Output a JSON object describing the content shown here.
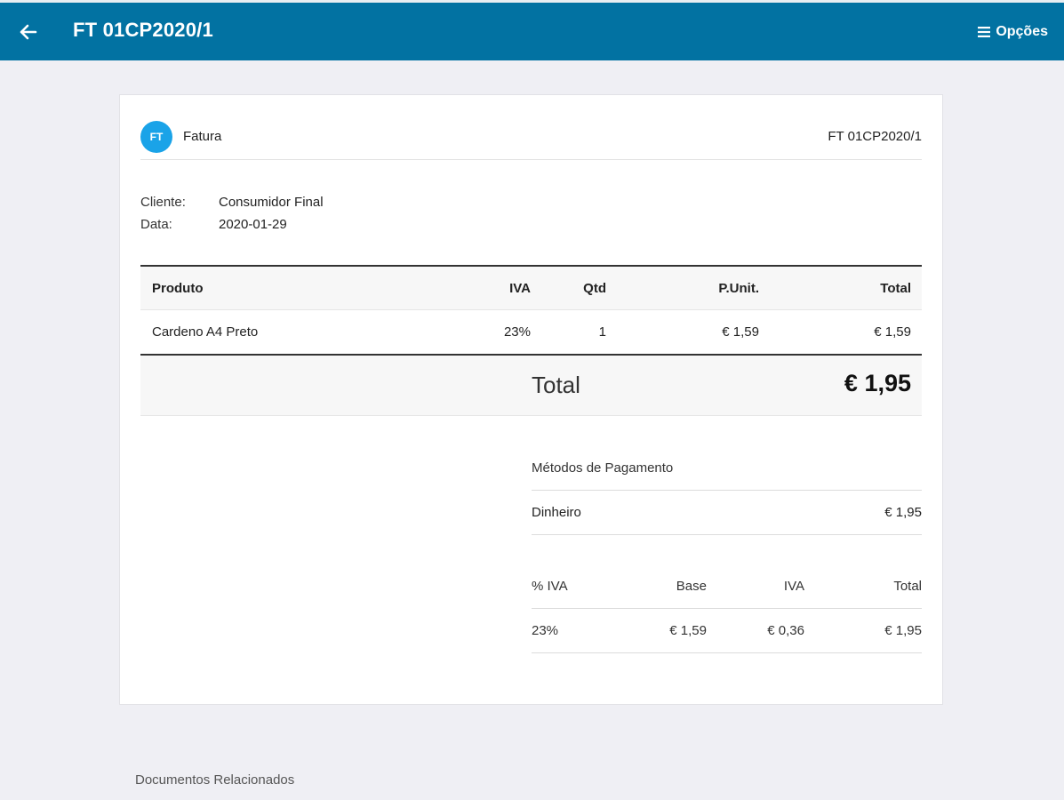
{
  "header": {
    "title": "FT 01CP2020/1",
    "options_label": "Opções",
    "accent": "#0272a2"
  },
  "document": {
    "badge": "FT",
    "type": "Fatura",
    "number": "FT 01CP2020/1",
    "client_label": "Cliente:",
    "client_value": "Consumidor Final",
    "date_label": "Data:",
    "date_value": "2020-01-29"
  },
  "items": {
    "headers": {
      "product": "Produto",
      "vat": "IVA",
      "qty": "Qtd",
      "unit_price": "P.Unit.",
      "total": "Total"
    },
    "rows": [
      {
        "product": "Cardeno A4 Preto",
        "vat": "23%",
        "qty": "1",
        "unit_price": "€ 1,59",
        "total": "€ 1,59"
      }
    ]
  },
  "totals": {
    "label": "Total",
    "value": "€ 1,95"
  },
  "payments": {
    "title": "Métodos de Pagamento",
    "rows": [
      {
        "method": "Dinheiro",
        "amount": "€ 1,95"
      }
    ]
  },
  "vat_summary": {
    "headers": {
      "pct": "% IVA",
      "base": "Base",
      "vat": "IVA",
      "total": "Total"
    },
    "rows": [
      {
        "pct": "23%",
        "base": "€ 1,59",
        "vat": "€ 0,36",
        "total": "€ 1,95"
      }
    ]
  },
  "related": {
    "label": "Documentos Relacionados"
  }
}
